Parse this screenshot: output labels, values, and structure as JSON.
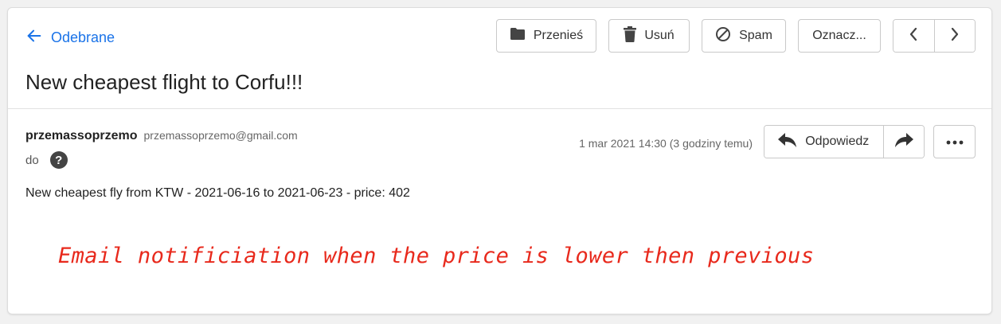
{
  "header": {
    "back_label": "Odebrane",
    "toolbar": {
      "move_label": "Przenieś",
      "delete_label": "Usuń",
      "spam_label": "Spam",
      "mark_label": "Oznacz..."
    }
  },
  "message": {
    "subject": "New cheapest flight to Corfu!!!",
    "sender_name": "przemassoprzemo",
    "sender_email": "przemassoprzemo@gmail.com",
    "to_label": "do",
    "help_glyph": "?",
    "date": "1 mar 2021 14:30 (3 godziny temu)",
    "reply_label": "Odpowiedz",
    "body": "New cheapest fly from KTW - 2021-06-16 to 2021-06-23 - price: 402"
  },
  "annotation": {
    "text": "Email notificiation when the price is lower then previous",
    "color": "#e8291c"
  },
  "colors": {
    "accent": "#1a73e8",
    "background": "#f1f1f1"
  },
  "icons": [
    "arrow-left-icon",
    "folder-icon",
    "trash-icon",
    "block-icon",
    "chevron-left-icon",
    "chevron-right-icon",
    "reply-icon",
    "forward-icon",
    "more-icon",
    "help-icon"
  ]
}
